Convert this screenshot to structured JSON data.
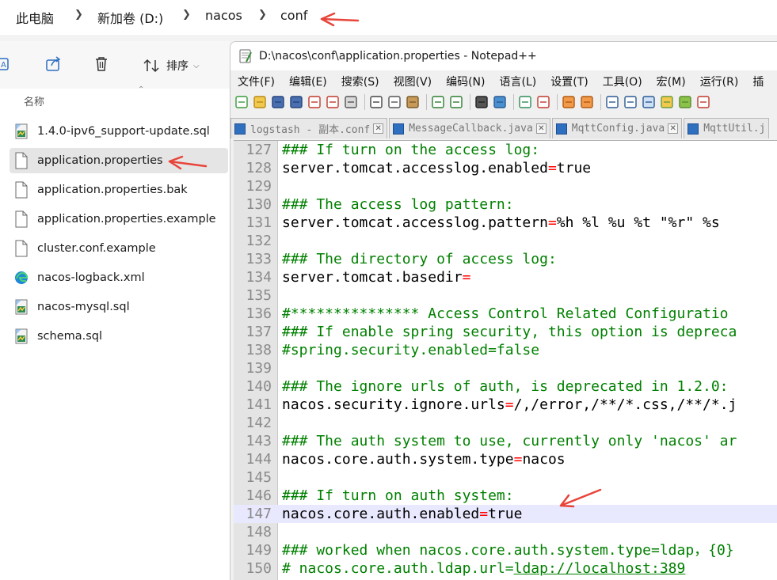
{
  "explorer": {
    "breadcrumb": [
      "此电脑",
      "新加卷 (D:)",
      "nacos",
      "conf"
    ],
    "toolbar": {
      "sort_label": "排序"
    },
    "column_header": "名称",
    "files": [
      {
        "name": "1.4.0-ipv6_support-update.sql",
        "icon": "sql-file-icon",
        "selected": false
      },
      {
        "name": "application.properties",
        "icon": "text-file-icon",
        "selected": true
      },
      {
        "name": "application.properties.bak",
        "icon": "text-file-icon",
        "selected": false
      },
      {
        "name": "application.properties.example",
        "icon": "text-file-icon",
        "selected": false
      },
      {
        "name": "cluster.conf.example",
        "icon": "text-file-icon",
        "selected": false
      },
      {
        "name": "nacos-logback.xml",
        "icon": "edge-icon",
        "selected": false
      },
      {
        "name": "nacos-mysql.sql",
        "icon": "sql-file-icon",
        "selected": false
      },
      {
        "name": "schema.sql",
        "icon": "sql-file-icon",
        "selected": false
      }
    ]
  },
  "notepad": {
    "title": "D:\\nacos\\conf\\application.properties - Notepad++",
    "menu": [
      "文件(F)",
      "编辑(E)",
      "搜索(S)",
      "视图(V)",
      "编码(N)",
      "语言(L)",
      "设置(T)",
      "工具(O)",
      "宏(M)",
      "运行(R)",
      "插"
    ],
    "tabs": [
      "logstash - 副本.conf",
      "MessageCallback.java",
      "MqttConfig.java",
      "MqttUtil.j"
    ],
    "lines": [
      {
        "n": "127",
        "kind": "comment",
        "text": "### If turn on the access log:"
      },
      {
        "n": "128",
        "kind": "kv",
        "key": "server.tomcat.accesslog.enabled",
        "value": "true"
      },
      {
        "n": "129",
        "kind": "blank",
        "text": ""
      },
      {
        "n": "130",
        "kind": "comment",
        "text": "### The access log pattern:"
      },
      {
        "n": "131",
        "kind": "kv",
        "key": "server.tomcat.accesslog.pattern",
        "value": "%h %l %u %t \"%r\" %s"
      },
      {
        "n": "132",
        "kind": "blank",
        "text": ""
      },
      {
        "n": "133",
        "kind": "comment",
        "text": "### The directory of access log:"
      },
      {
        "n": "134",
        "kind": "kv",
        "key": "server.tomcat.basedir",
        "value": ""
      },
      {
        "n": "135",
        "kind": "blank",
        "text": ""
      },
      {
        "n": "136",
        "kind": "comment",
        "text": "#*************** Access Control Related Configuratio"
      },
      {
        "n": "137",
        "kind": "comment",
        "text": "### If enable spring security, this option is depreca"
      },
      {
        "n": "138",
        "kind": "comment",
        "text": "#spring.security.enabled=false"
      },
      {
        "n": "139",
        "kind": "blank",
        "text": ""
      },
      {
        "n": "140",
        "kind": "comment",
        "text": "### The ignore urls of auth, is deprecated in 1.2.0:"
      },
      {
        "n": "141",
        "kind": "kv",
        "key": "nacos.security.ignore.urls",
        "value": "/,/error,/**/*.css,/**/*.j"
      },
      {
        "n": "142",
        "kind": "blank",
        "text": ""
      },
      {
        "n": "143",
        "kind": "comment",
        "text": "### The auth system to use, currently only 'nacos' ar"
      },
      {
        "n": "144",
        "kind": "kv",
        "key": "nacos.core.auth.system.type",
        "value": "nacos"
      },
      {
        "n": "145",
        "kind": "blank",
        "text": ""
      },
      {
        "n": "146",
        "kind": "comment",
        "text": "### If turn on auth system:"
      },
      {
        "n": "147",
        "kind": "kv",
        "key": "nacos.core.auth.enabled",
        "value": "true",
        "current": true
      },
      {
        "n": "148",
        "kind": "blank",
        "text": ""
      },
      {
        "n": "149",
        "kind": "comment",
        "text": "### worked when nacos.core.auth.system.type=ldap，{0}"
      },
      {
        "n": "150",
        "kind": "link",
        "prefix": "# nacos.core.auth.ldap.url=",
        "link": "ldap://localhost:389"
      }
    ]
  },
  "colors": {
    "comment": "#008000",
    "operator": "#ff0000",
    "arrow": "#e8443a",
    "current_line": "#e8e8ff"
  }
}
